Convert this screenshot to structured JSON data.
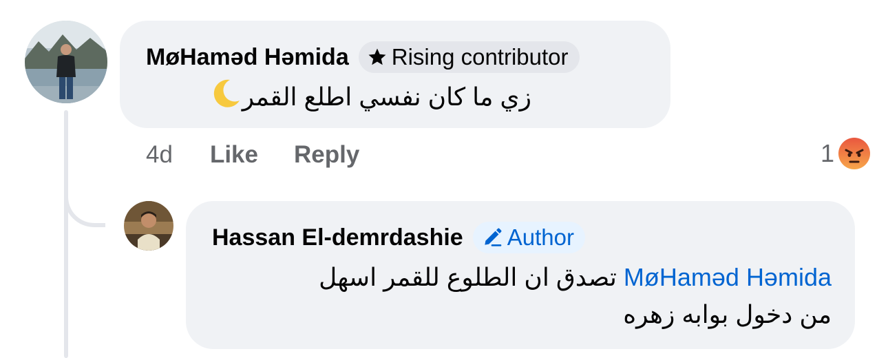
{
  "colors": {
    "bubble_bg": "#f0f2f5",
    "badge_rising_bg": "#e4e6eb",
    "badge_author_bg": "#e7f3ff",
    "author_blue": "#0064d1",
    "meta_gray": "#65676b",
    "thread_line": "#e4e6eb",
    "angry_orange": "#f0643c"
  },
  "comment": {
    "author": "MøHaməd Həmida",
    "badge_label": "Rising contributor",
    "badge_icon": "star-icon",
    "text": "زي ما كان نفسي اطلع القمر",
    "emoji": "crescent-moon-icon",
    "time": "4d",
    "like_label": "Like",
    "reply_label": "Reply",
    "reaction_count": "1",
    "reaction_icon": "angry-face-icon"
  },
  "reply": {
    "author": "Hassan El-demrdashie",
    "badge_label": "Author",
    "badge_icon": "pencil-icon",
    "mention": "MøHaməd Həmida",
    "text_line1": "تصدق ان الطلوع للقمر اسهل",
    "text_line2": "من دخول بوابه زهره"
  }
}
